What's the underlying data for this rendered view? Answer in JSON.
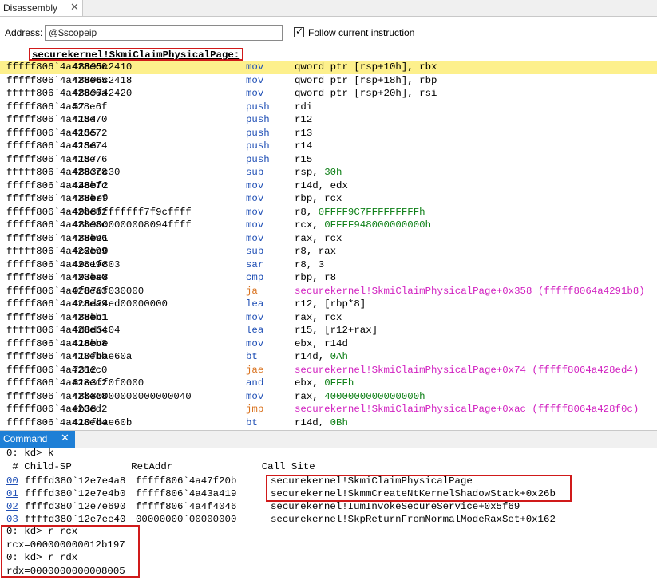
{
  "disassembly_tab": {
    "title": "Disassembly",
    "close": "✕"
  },
  "address": {
    "label": "Address:",
    "value": "@$scopeip",
    "follow_label": "Follow current instruction",
    "follow_checked": true
  },
  "symbol_header": "securekernel!SkmiClaimPhysicalPage:",
  "instructions": [
    {
      "addr": "fffff806`4a428e60",
      "bytes": "48895c2410",
      "op": "mov",
      "args": "qword ptr [rsp+10h], rbx",
      "current": true
    },
    {
      "addr": "fffff806`4a428e65",
      "bytes": "48896c2418",
      "op": "mov",
      "args": "qword ptr [rsp+18h], rbp"
    },
    {
      "addr": "fffff806`4a428e6a",
      "bytes": "4889742420",
      "op": "mov",
      "args": "qword ptr [rsp+20h], rsi"
    },
    {
      "addr": "fffff806`4a428e6f",
      "bytes": "57",
      "op": "push",
      "args": "rdi"
    },
    {
      "addr": "fffff806`4a428e70",
      "bytes": "4154",
      "op": "push",
      "args": "r12"
    },
    {
      "addr": "fffff806`4a428e72",
      "bytes": "4155",
      "op": "push",
      "args": "r13"
    },
    {
      "addr": "fffff806`4a428e74",
      "bytes": "4156",
      "op": "push",
      "args": "r14"
    },
    {
      "addr": "fffff806`4a428e76",
      "bytes": "4157",
      "op": "push",
      "args": "r15"
    },
    {
      "addr": "fffff806`4a428e78",
      "bytes": "4883ec30",
      "op": "sub",
      "args": "rsp, 30h"
    },
    {
      "addr": "fffff806`4a428e7c",
      "bytes": "448bf2",
      "op": "mov",
      "args": "r14d, edx"
    },
    {
      "addr": "fffff806`4a428e7f",
      "bytes": "488be9",
      "op": "mov",
      "args": "rbp, rcx"
    },
    {
      "addr": "fffff806`4a428e82",
      "bytes": "49b8ffffffff7f9cffff",
      "op": "mov",
      "args": "r8, 0FFFF9C7FFFFFFFFFh"
    },
    {
      "addr": "fffff806`4a428e8c",
      "bytes": "48b9000000008094ffff",
      "op": "mov",
      "args": "rcx, 0FFFF948000000000h"
    },
    {
      "addr": "fffff806`4a428e96",
      "bytes": "488bc1",
      "op": "mov",
      "args": "rax, rcx"
    },
    {
      "addr": "fffff806`4a428e99",
      "bytes": "4c2bc0",
      "op": "sub",
      "args": "r8, rax"
    },
    {
      "addr": "fffff806`4a428e9c",
      "bytes": "49c1f803",
      "op": "sar",
      "args": "r8, 3"
    },
    {
      "addr": "fffff806`4a428ea0",
      "bytes": "493be8",
      "op": "cmp",
      "args": "rbp, r8"
    },
    {
      "addr": "fffff806`4a428ea3",
      "bytes": "0f870f030000",
      "op": "ja",
      "args": "securekernel!SkmiClaimPhysicalPage+0x358 (fffff8064a4291b8)",
      "branch": true
    },
    {
      "addr": "fffff806`4a428ea9",
      "bytes": "4c8d24ed00000000",
      "op": "lea",
      "args": "r12, [rbp*8]"
    },
    {
      "addr": "fffff806`4a428eb1",
      "bytes": "488bc1",
      "op": "mov",
      "args": "rax, rcx"
    },
    {
      "addr": "fffff806`4a428eb4",
      "bytes": "4d8d3c04",
      "op": "lea",
      "args": "r15, [r12+rax]"
    },
    {
      "addr": "fffff806`4a428eb8",
      "bytes": "418bde",
      "op": "mov",
      "args": "ebx, r14d"
    },
    {
      "addr": "fffff806`4a428ebb",
      "bytes": "410fbae60a",
      "op": "bt",
      "args": "r14d, 0Ah"
    },
    {
      "addr": "fffff806`4a428ec0",
      "bytes": "7312",
      "op": "jae",
      "args": "securekernel!SkmiClaimPhysicalPage+0x74 (fffff8064a428ed4)",
      "branch": true
    },
    {
      "addr": "fffff806`4a428ec2",
      "bytes": "81e3ff0f0000",
      "op": "and",
      "args": "ebx, 0FFFh"
    },
    {
      "addr": "fffff806`4a428ec8",
      "bytes": "48b80000000000000040",
      "op": "mov",
      "args": "rax, 4000000000000000h"
    },
    {
      "addr": "fffff806`4a428ed2",
      "bytes": "eb38",
      "op": "jmp",
      "args": "securekernel!SkmiClaimPhysicalPage+0xac (fffff8064a428f0c)",
      "branch": true
    },
    {
      "addr": "fffff806`4a428ed4",
      "bytes": "410fbae60b",
      "op": "bt",
      "args": "r14d, 0Bh"
    }
  ],
  "command_tab": {
    "title": "Command",
    "close": "✕"
  },
  "command": {
    "prompt_k": "0: kd> k",
    "header": " # Child-SP          RetAddr               Call Site",
    "frames": [
      {
        "num": "00",
        "sp": "ffffd380`12e7e4a8",
        "ret": "fffff806`4a47f20b",
        "site": "securekernel!SkmiClaimPhysicalPage"
      },
      {
        "num": "01",
        "sp": "ffffd380`12e7e4b0",
        "ret": "fffff806`4a43a419",
        "site": "securekernel!SkmmCreateNtKernelShadowStack+0x26b"
      },
      {
        "num": "02",
        "sp": "ffffd380`12e7e690",
        "ret": "fffff806`4a4f4046",
        "site": "securekernel!IumInvokeSecureService+0x5f69"
      },
      {
        "num": "03",
        "sp": "ffffd380`12e7ee40",
        "ret": "00000000`00000000",
        "site": "securekernel!SkpReturnFromNormalModeRaxSet+0x162"
      }
    ],
    "prompt_rcx": "0: kd> r rcx",
    "rcx": "rcx=000000000012b197",
    "prompt_rdx": "0: kd> r rdx",
    "rdx": "rdx=0000000000008005"
  }
}
